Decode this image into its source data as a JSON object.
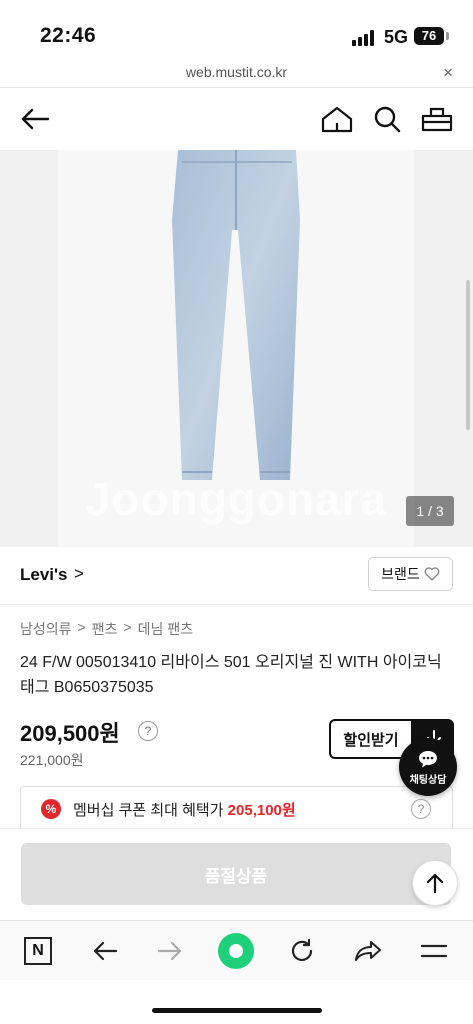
{
  "status": {
    "time": "22:46",
    "network": "5G",
    "battery": "76"
  },
  "url_bar": {
    "url": "web.mustit.co.kr",
    "close": "×"
  },
  "image": {
    "watermark": "Joonggonara",
    "counter": "1 / 3"
  },
  "brand": {
    "name": "Levi's",
    "chevron": ">",
    "button": "브랜드"
  },
  "breadcrumb": [
    "남성의류",
    ">",
    "팬츠",
    ">",
    "데님 팬츠"
  ],
  "product": {
    "title": "24 F/W 005013410 리바이스 501 오리지널 진 WITH 아이코닉 태그 B0650375035",
    "price": "209,500원",
    "help": "?",
    "original_price": "221,000원",
    "discount_button": "할인받기"
  },
  "coupon": {
    "badge": "%",
    "text": "멤버십 쿠폰 최대 혜택가 ",
    "amount": "205,100원",
    "help": "?"
  },
  "chat": {
    "label": "채팅상담"
  },
  "cta": {
    "label": "품절상품"
  },
  "toolbar": {
    "naver": "N"
  }
}
